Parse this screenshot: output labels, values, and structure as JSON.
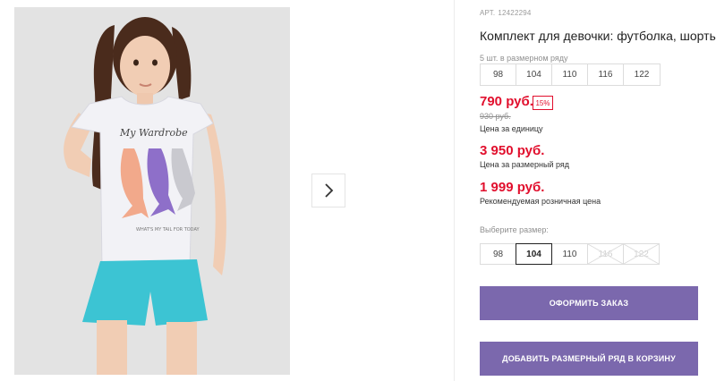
{
  "product": {
    "sku_label": "АРТ.",
    "sku": "12422294",
    "title": "Комплект для девочки: футболка, шорты"
  },
  "gallery": {
    "next_icon": "chevron-right-icon",
    "image_subject": "girl-in-tshirt-and-shorts",
    "shirt_print_text": "My Wardrobe",
    "shirt_caption_text": "WHAT'S MY TAIL FOR TODAY",
    "colors": {
      "background": "#e3e3e3",
      "shirt": "#f2f2f6",
      "shorts": "#3cc4d3"
    }
  },
  "size_range": {
    "note": "5 шт. в размерном ряду",
    "sizes": [
      "98",
      "104",
      "110",
      "116",
      "122"
    ]
  },
  "prices": {
    "unit_price": "790 руб.",
    "discount": "15%",
    "old_price": "930 руб.",
    "unit_caption": "Цена за единицу",
    "row_price": "3 950 руб.",
    "row_caption": "Цена за размерный ряд",
    "retail_price": "1 999 руб.",
    "retail_caption": "Рекомендуемая розничная цена"
  },
  "size_picker": {
    "label": "Выберите размер:",
    "options": [
      {
        "label": "98",
        "state": "available"
      },
      {
        "label": "104",
        "state": "selected"
      },
      {
        "label": "110",
        "state": "available"
      },
      {
        "label": "116",
        "state": "unavailable"
      },
      {
        "label": "122",
        "state": "unavailable"
      }
    ]
  },
  "actions": {
    "order_label": "ОФОРМИТЬ ЗАКАЗ",
    "add_row_label": "ДОБАВИТЬ РАЗМЕРНЫЙ РЯД В КОРЗИНУ"
  },
  "theme": {
    "accent": "#7b68ad",
    "price_red": "#e10f2d"
  }
}
